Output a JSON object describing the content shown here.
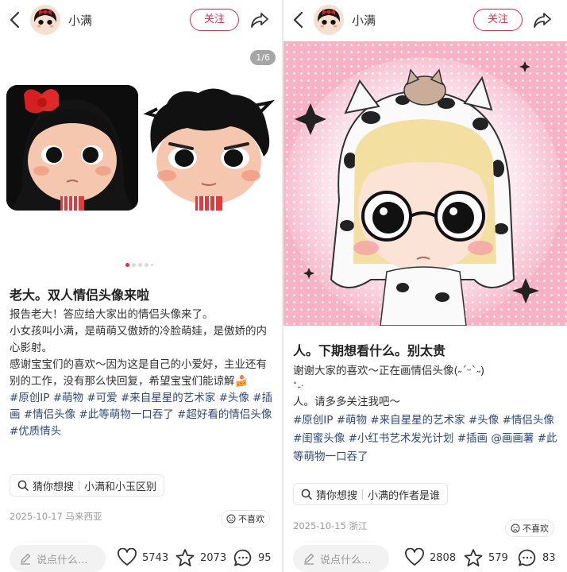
{
  "left": {
    "author": "小满",
    "follow_label": "关注",
    "image_counter": "1/6",
    "title": "老大。双人情侣头像来啦",
    "body_lines": [
      "报告老大！答应给大家出的情侣头像来了。",
      "小女孩叫小满，是萌萌又傲娇的冷脸萌娃，是傲娇的内心影射。",
      "感谢宝宝们的喜欢～因为这是自己的小爱好，主业还有别的工作，没有那么快回复，希望宝宝们能谅解🍰"
    ],
    "tags": [
      "#原创IP",
      "#萌物",
      "#可爱",
      "#来自星星的艺术家",
      "#头像",
      "#插画",
      "#情侣头像",
      "#此等萌物一口吞了",
      "#超好看的情侣头像",
      "#优质情头"
    ],
    "guess_label": "猜你想搜",
    "guess_query": "小满和小玉区别",
    "meta": "2025-10-17 马来西亚",
    "dislike_label": "不喜欢",
    "comment_placeholder": "说点什么...",
    "likes": "5743",
    "stars": "2073",
    "comments": "95"
  },
  "right": {
    "author": "小满",
    "follow_label": "关注",
    "title": "人。下期想看什么。别太贵",
    "body_lines": [
      "谢谢大家的喜欢～正在画情侣头像(˶ˊᵕˋ˶)",
      "˚₊‧",
      "人。请多多关注我吧～"
    ],
    "tags": [
      "#原创IP",
      "#萌物",
      "#来自星星的艺术家",
      "#头像",
      "#情侣头像",
      "#闺蜜头像",
      "#小红书艺术发光计划",
      "#插画",
      "@画画薯",
      "#此等萌物一口吞了"
    ],
    "guess_label": "猜你想搜",
    "guess_query": "小满的作者是谁",
    "meta": "2025-10-15 浙江",
    "dislike_label": "不喜欢",
    "comment_placeholder": "说点什么...",
    "likes": "2808",
    "stars": "579",
    "comments": "83"
  },
  "icons": [
    "back-arrow-icon",
    "share-icon",
    "search-icon",
    "pencil-icon",
    "heart-icon",
    "star-icon",
    "comment-bubble-icon",
    "dislike-face-icon"
  ],
  "colors": {
    "accent": "#ff2442",
    "tag": "#2e4b7d",
    "pink_bg": "#f7b2c8"
  }
}
